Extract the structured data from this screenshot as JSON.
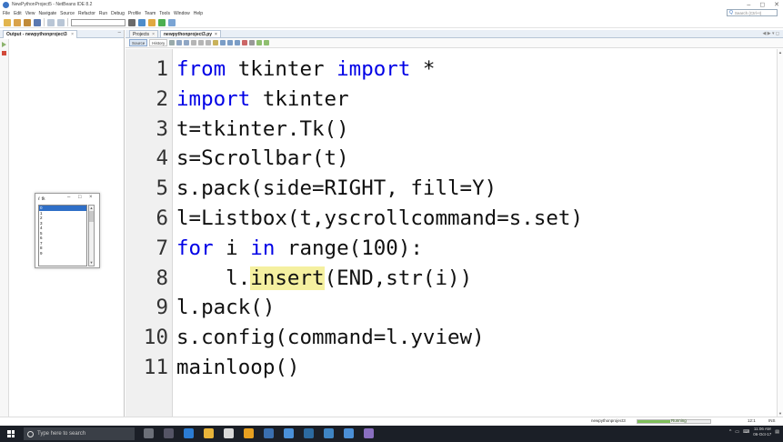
{
  "window": {
    "title": "NewPythonProject5 - NetBeans IDE 8.2",
    "minimize": "–",
    "restore": "◻",
    "close": "✕"
  },
  "menu": [
    "File",
    "Edit",
    "View",
    "Navigate",
    "Source",
    "Refactor",
    "Run",
    "Debug",
    "Profile",
    "Team",
    "Tools",
    "Window",
    "Help"
  ],
  "search": {
    "placeholder": "Search (Ctrl+I)"
  },
  "output_panel": {
    "tab_label": "Output - newpythonproject3",
    "tab_close": "×",
    "minimize": "–"
  },
  "tk_window": {
    "title": "tk",
    "minimize": "–",
    "maximize": "□",
    "close": "×",
    "items": [
      "0",
      "1",
      "2",
      "3",
      "4",
      "5",
      "6",
      "7",
      "8",
      "9"
    ],
    "selected_index": 0
  },
  "editor": {
    "tabs": [
      {
        "label": "Projects",
        "close": "×"
      },
      {
        "label": "newpythonproject3.py",
        "close": "×"
      }
    ],
    "modes": {
      "source": "Source",
      "history": "History"
    },
    "lines": [
      {
        "num": "1",
        "parts": [
          {
            "t": "from",
            "c": "kw"
          },
          {
            "t": " tkinter "
          },
          {
            "t": "import",
            "c": "kw"
          },
          {
            "t": " *"
          }
        ]
      },
      {
        "num": "2",
        "parts": [
          {
            "t": "import",
            "c": "kw"
          },
          {
            "t": " tkinter"
          }
        ]
      },
      {
        "num": "3",
        "parts": [
          {
            "t": "t=tkinter.Tk()"
          }
        ]
      },
      {
        "num": "4",
        "parts": [
          {
            "t": "s=Scrollbar(t)"
          }
        ]
      },
      {
        "num": "5",
        "parts": [
          {
            "t": "s.pack(side=RIGHT, fill=Y)"
          }
        ]
      },
      {
        "num": "6",
        "parts": [
          {
            "t": "l=Listbox(t,yscrollcommand=s.set)"
          }
        ]
      },
      {
        "num": "7",
        "parts": [
          {
            "t": "for",
            "c": "kw"
          },
          {
            "t": " i "
          },
          {
            "t": "in",
            "c": "kw"
          },
          {
            "t": " range(100):"
          }
        ]
      },
      {
        "num": "8",
        "parts": [
          {
            "t": "    l."
          },
          {
            "t": "insert",
            "c": "hl"
          },
          {
            "t": "(END,str(i))"
          }
        ]
      },
      {
        "num": "9",
        "parts": [
          {
            "t": "l.pack()"
          }
        ]
      },
      {
        "num": "10",
        "parts": [
          {
            "t": "s.config(command=l.yview)"
          }
        ]
      },
      {
        "num": "11",
        "parts": [
          {
            "t": "mainloop()"
          }
        ]
      }
    ]
  },
  "status": {
    "project": "newpythonproject3",
    "running": "Running",
    "progress": 0.45,
    "position": "12:1",
    "mode": "INS"
  },
  "taskbar": {
    "search_placeholder": "Type here to search",
    "time": "11:06 AM",
    "date": "06-Oct-17"
  },
  "colors": {
    "keyword": "#0000e6",
    "highlight": "#f5f0a0",
    "listbox_selection": "#2f6fc7",
    "taskbar": "#1b1f27"
  }
}
